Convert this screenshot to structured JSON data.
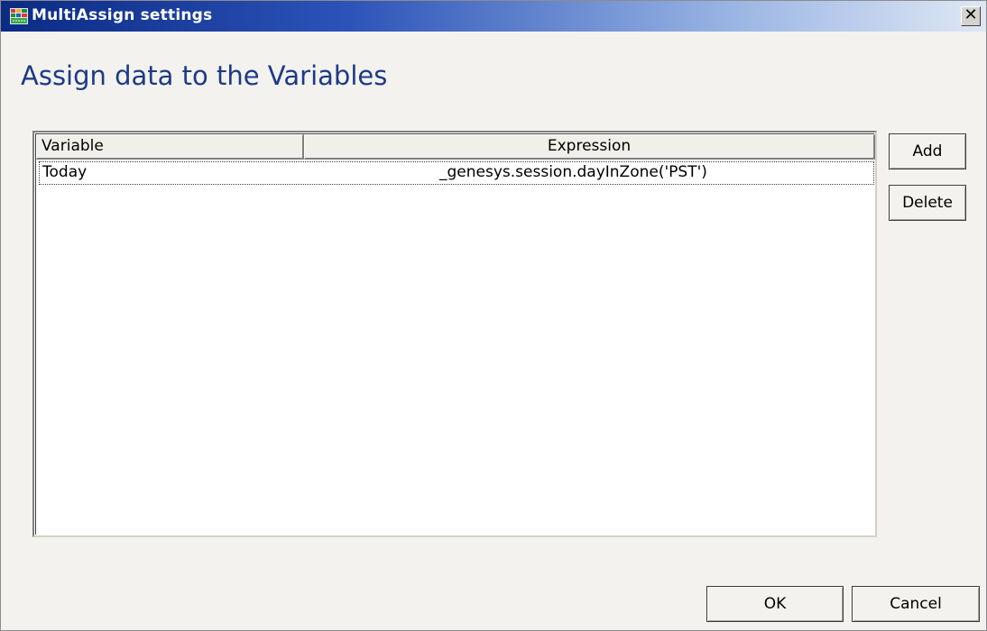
{
  "window": {
    "title": "MultiAssign settings",
    "close_symbol": "✕"
  },
  "heading": "Assign data to the Variables",
  "grid": {
    "columns": [
      "Variable",
      "Expression"
    ],
    "rows": [
      {
        "variable": "Today",
        "expression": "_genesys.session.dayInZone('PST')"
      }
    ]
  },
  "buttons": {
    "add": "Add",
    "delete": "Delete",
    "ok": "OK",
    "cancel": "Cancel"
  },
  "colors": {
    "titlebar_start": "#0b2a84",
    "heading": "#1d3a86",
    "dialog_bg": "#f3f2ee"
  }
}
